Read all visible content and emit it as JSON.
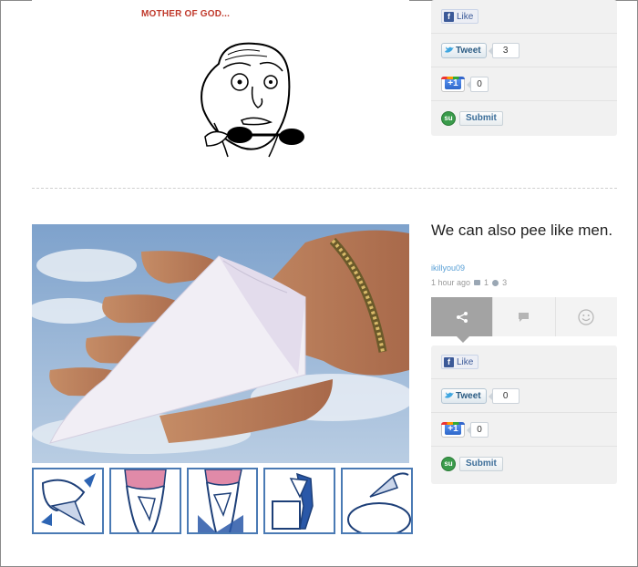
{
  "top_post": {
    "meme_caption": "MOTHER OF GOD...",
    "share": {
      "like_label": "Like",
      "tweet_label": "Tweet",
      "tweet_count": "3",
      "plusone_label": "+1",
      "plusone_count": "0",
      "submit_label": "Submit"
    }
  },
  "post": {
    "title": "We can also pee like men.",
    "author": "ikillyou09",
    "time": "1 hour ago",
    "comment_count": "1",
    "emotion_count": "3",
    "share": {
      "like_label": "Like",
      "tweet_label": "Tweet",
      "tweet_count": "0",
      "plusone_label": "+1",
      "plusone_count": "0",
      "submit_label": "Submit"
    },
    "action_tabs": [
      "share",
      "comment",
      "emotion"
    ]
  },
  "icons": {
    "facebook": "facebook-icon",
    "twitter": "twitter-bird-icon",
    "google_plus": "google-plus-icon",
    "stumbleupon": "stumbleupon-icon",
    "share": "share-icon",
    "comment": "comment-icon",
    "smiley": "smiley-icon"
  },
  "colors": {
    "caption_red": "#c0392b",
    "author_blue": "#5aa0d6",
    "panel_bg": "#f1f1f1",
    "active_tab": "#a3a3a3",
    "instruction_border": "#4a7ab4"
  }
}
